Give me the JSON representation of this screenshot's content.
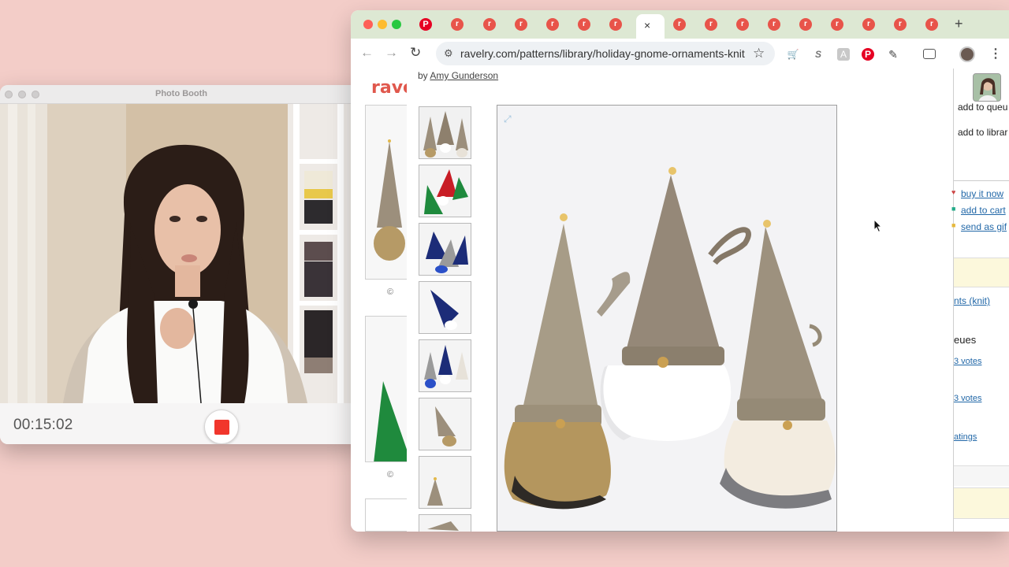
{
  "photo_booth": {
    "title": "Photo Booth",
    "timer": "00:15:02"
  },
  "browser": {
    "url": "ravelry.com/patterns/library/holiday-gnome-ornaments-knit",
    "tab_close": "×",
    "new_tab": "+"
  },
  "page": {
    "logo": "rave",
    "copyright_symbol": "©",
    "byline_prefix": "by ",
    "designer": "Amy Gunderson"
  },
  "right_panel": {
    "add_to_queue": "add to queu",
    "add_to_library": "add to librar",
    "buy_it_now": "buy it now",
    "add_to_cart": "add to cart",
    "send_as_gift": "send as gif",
    "craft_type": "nts (knit)",
    "queues": "eues",
    "votes_1": "3 votes",
    "votes_2": "3 votes",
    "ratings": "atings"
  },
  "colors": {
    "background": "#f3cdc8",
    "tab_strip": "#dde8d3",
    "ravelry_red": "#e0584d",
    "record_red": "#f1362c",
    "link_blue": "#2268a8"
  }
}
